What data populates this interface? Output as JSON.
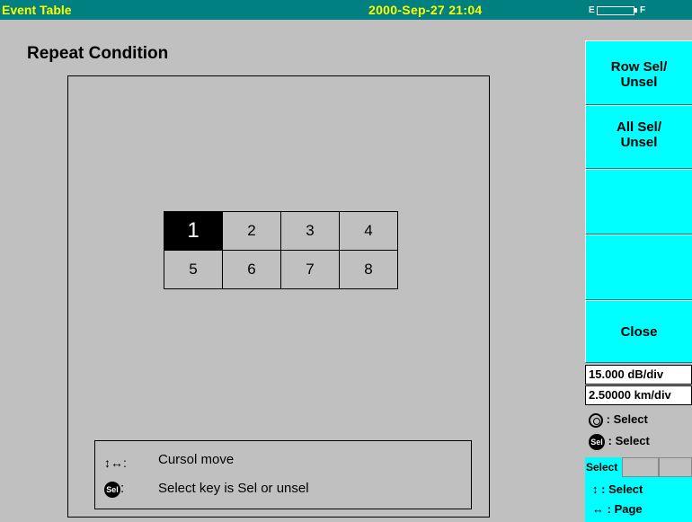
{
  "header": {
    "title": "Event Table",
    "datetime": "2000-Sep-27 21:04",
    "battery": {
      "empty_label": "E",
      "full_label": "F"
    }
  },
  "main": {
    "page_title": "Repeat Condition",
    "grid": {
      "rows": [
        [
          "1",
          "2",
          "3",
          "4"
        ],
        [
          "5",
          "6",
          "7",
          "8"
        ]
      ],
      "selected": "1"
    },
    "help": {
      "cursor_symbol": "↕↔:",
      "cursor_text": "Cursol move",
      "sel_key_symbol": "Sel",
      "sel_colon": ":",
      "sel_text": "Select key is Sel or unsel"
    }
  },
  "softkeys": {
    "row_sel": [
      "Row Sel/",
      "Unsel"
    ],
    "all_sel": [
      "All Sel/",
      "Unsel"
    ],
    "empty1": "",
    "empty2": "",
    "close": "Close"
  },
  "scale": {
    "db_per_div": "15.000 dB/div",
    "km_per_div": "2.50000 km/div"
  },
  "legend": {
    "knob_text": ": Select",
    "sel_text": ": Select"
  },
  "tabs": {
    "active": "Select"
  },
  "nav": {
    "updown": ": Select",
    "leftright": ": Page"
  },
  "colors": {
    "title_bg": "#008080",
    "title_fg": "#ffff00",
    "softkey_bg": "#00ffff",
    "background": "#c0c0c0"
  }
}
